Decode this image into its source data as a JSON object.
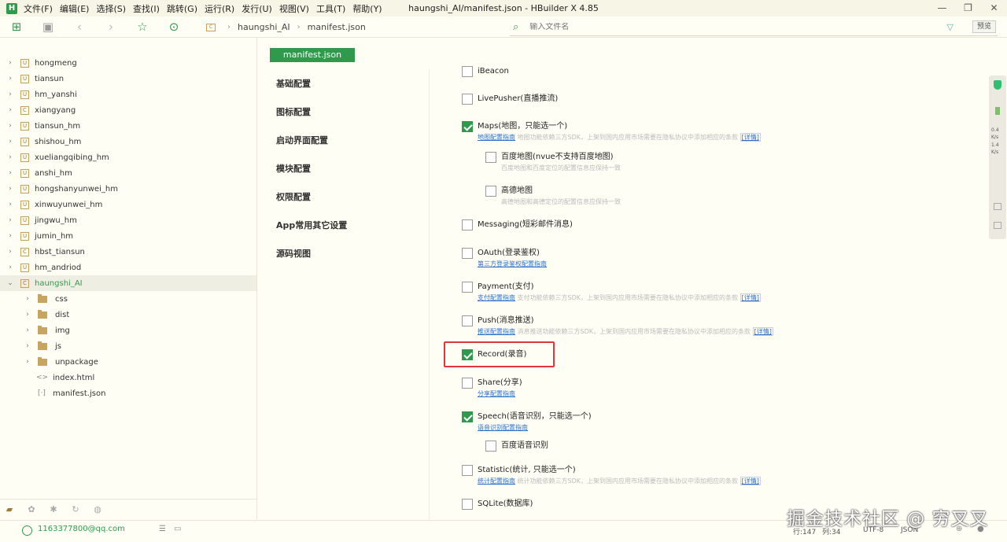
{
  "window": {
    "title": "haungshi_AI/manifest.json - HBuilder X 4.85",
    "logo": "H",
    "menu": [
      "文件(F)",
      "编辑(E)",
      "选择(S)",
      "查找(I)",
      "跳转(G)",
      "运行(R)",
      "发行(U)",
      "视图(V)",
      "工具(T)",
      "帮助(Y)"
    ],
    "controls": [
      "minimize-icon",
      "restore-icon",
      "close-icon"
    ]
  },
  "toolbar": {
    "icons": [
      "new-file-icon",
      "save-icon",
      "back-icon",
      "forward-icon",
      "star-icon",
      "run-icon"
    ],
    "breadcrumb": {
      "badge": "C",
      "project": "haungshi_AI",
      "file": "manifest.json"
    },
    "search_placeholder": "输入文件名",
    "preview_label": "预览"
  },
  "sidebar": {
    "projects": [
      {
        "name": "hongmeng",
        "badge": "U"
      },
      {
        "name": "tiansun",
        "badge": "U"
      },
      {
        "name": "hm_yanshi",
        "badge": "U"
      },
      {
        "name": "xiangyang",
        "badge": "C"
      },
      {
        "name": "tiansun_hm",
        "badge": "U"
      },
      {
        "name": "shishou_hm",
        "badge": "U"
      },
      {
        "name": "xueliangqibing_hm",
        "badge": "U"
      },
      {
        "name": "anshi_hm",
        "badge": "U"
      },
      {
        "name": "hongshanyunwei_hm",
        "badge": "U"
      },
      {
        "name": "xinwuyunwei_hm",
        "badge": "U"
      },
      {
        "name": "jingwu_hm",
        "badge": "U"
      },
      {
        "name": "jumin_hm",
        "badge": "U"
      },
      {
        "name": "hbst_tiansun",
        "badge": "C"
      },
      {
        "name": "hm_andriod",
        "badge": "U"
      },
      {
        "name": "haungshi_AI",
        "badge": "C"
      }
    ],
    "children": [
      {
        "name": "css",
        "kind": "folder"
      },
      {
        "name": "dist",
        "kind": "folder"
      },
      {
        "name": "img",
        "kind": "folder"
      },
      {
        "name": "js",
        "kind": "folder"
      },
      {
        "name": "unpackage",
        "kind": "folder"
      },
      {
        "name": "index.html",
        "kind": "html",
        "glyph": "<>"
      },
      {
        "name": "manifest.json",
        "kind": "json",
        "glyph": "[·]"
      }
    ],
    "bottom_icons": [
      "project-manager-icon",
      "plugin-icon",
      "bug-icon",
      "refresh-icon",
      "palette-icon"
    ]
  },
  "main": {
    "tab_label": "manifest.json",
    "nav": [
      "基础配置",
      "图标配置",
      "启动界面配置",
      "模块配置",
      "权限配置",
      "App常用其它设置",
      "源码视图"
    ],
    "options": [
      {
        "label": "iBeacon",
        "checked": false,
        "sub": false
      },
      {
        "label": "LivePusher(直播推流)",
        "checked": false,
        "sub": false
      },
      {
        "label": "Maps(地图，只能选一个)",
        "checked": true,
        "sub": false,
        "link": "地图配置指南",
        "desc": "地图功能依赖三方SDK，上架到国内应用市场需要在隐私协议中添加相应的条款",
        "detail": "[详情]"
      },
      {
        "label": "百度地图(nvue不支持百度地图)",
        "checked": false,
        "sub": true,
        "desc": "百度地图和百度定位的配置信息应保持一致"
      },
      {
        "label": "高德地图",
        "checked": false,
        "sub": true,
        "desc": "高德地图和高德定位的配置信息应保持一致"
      },
      {
        "label": "Messaging(短彩邮件消息)",
        "checked": false,
        "sub": false
      },
      {
        "label": "OAuth(登录鉴权)",
        "checked": false,
        "sub": false,
        "link": "第三方登录鉴权配置指南"
      },
      {
        "label": "Payment(支付)",
        "checked": false,
        "sub": false,
        "link": "支付配置指南",
        "desc": "支付功能依赖三方SDK，上架到国内应用市场需要在隐私协议中添加相应的条款",
        "detail": "[详情]"
      },
      {
        "label": "Push(消息推送)",
        "checked": false,
        "sub": false,
        "link": "推送配置指南",
        "desc": "消息推送功能依赖三方SDK，上架到国内应用市场需要在隐私协议中添加相应的条款",
        "detail": "[详情]"
      },
      {
        "label": "Record(录音)",
        "checked": true,
        "sub": false
      },
      {
        "label": "Share(分享)",
        "checked": false,
        "sub": false,
        "link": "分享配置指南"
      },
      {
        "label": "Speech(语音识别，只能选一个)",
        "checked": true,
        "sub": false,
        "link": "语音识别配置指南"
      },
      {
        "label": "百度语音识别",
        "checked": false,
        "sub": true
      },
      {
        "label": "Statistic(统计, 只能选一个)",
        "checked": false,
        "sub": false,
        "link": "统计配置指南",
        "desc": "统计功能依赖三方SDK，上架到国内应用市场需要在隐私协议中添加相应的条款",
        "detail": "[详情]"
      },
      {
        "label": "SQLite(数据库)",
        "checked": false,
        "sub": false
      }
    ],
    "highlighted_option": "Record(录音)",
    "highlight_color": "#e0353b"
  },
  "minimap": {
    "stats": [
      "0.4",
      "K/s",
      "1.4",
      "K/s"
    ]
  },
  "statusbar": {
    "user": "1163377800@qq.com",
    "line": "行:147",
    "col": "列:34",
    "encoding": "UTF-8",
    "language": "JSON"
  },
  "watermark": "掘金技术社区 @ 穷叉叉",
  "colors": {
    "accent": "#2f9a4c",
    "link": "#2a6fc9",
    "background": "#fffef5"
  }
}
